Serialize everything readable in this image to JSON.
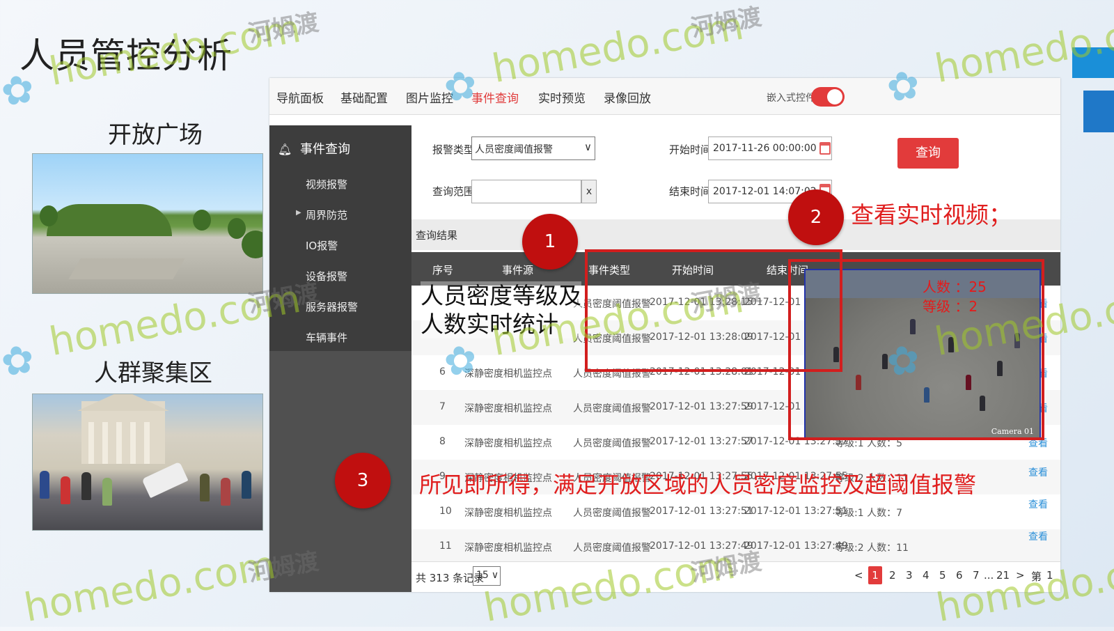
{
  "slide": {
    "title": "人员管控分析",
    "left_labels": [
      "开放广场",
      "人群聚集区"
    ]
  },
  "topnav": {
    "items": [
      "导航面板",
      "基础配置",
      "图片监控",
      "事件查询",
      "实时预览",
      "录像回放"
    ],
    "active": "事件查询",
    "embed_label": "嵌入式控件",
    "embed_toggle_on": true
  },
  "sidebar": {
    "header": "事件查询",
    "items": [
      "视频报警",
      "周界防范",
      "IO报警",
      "设备报警",
      "服务器报警",
      "车辆事件"
    ]
  },
  "form": {
    "alarm_type_label": "报警类型:",
    "alarm_type_value": "人员密度阈值报警",
    "range_label": "查询范围:",
    "range_value": "",
    "clear_label": "x",
    "start_label": "开始时间:",
    "start_value": "2017-11-26 00:00:00",
    "end_label": "结束时间:",
    "end_value": "2017-12-01 14:07:02",
    "query_button": "查询"
  },
  "results": {
    "label": "查询结果",
    "columns": [
      "序号",
      "事件源",
      "事件类型",
      "开始时间",
      "结束时间"
    ],
    "rows": [
      {
        "no": "",
        "source": "",
        "type": "人员密度阈值报警",
        "start": "2017-12-01 13:28:15",
        "end": "2017-12-01 13:",
        "info": "",
        "view": "查看"
      },
      {
        "no": "",
        "source": "",
        "type": "人员密度阈值报警",
        "start": "2017-12-01 13:28:09",
        "end": "2017-12-01 13",
        "info": "",
        "view": "查看"
      },
      {
        "no": "6",
        "source": "深静密度相机监控点",
        "type": "人员密度阈值报警",
        "start": "2017-12-01 13:28:01",
        "end": "2017-12-01 13",
        "info": "",
        "view": "查看"
      },
      {
        "no": "7",
        "source": "深静密度相机监控点",
        "type": "人员密度阈值报警",
        "start": "2017-12-01 13:27:59",
        "end": "2017-12-01 13",
        "info": "",
        "view": "查看"
      },
      {
        "no": "8",
        "source": "深静密度相机监控点",
        "type": "人员密度阈值报警",
        "start": "2017-12-01 13:27:57",
        "end": "2017-12-01 13:27:57",
        "info": "等级:1 人数：5",
        "view": "查看"
      },
      {
        "no": "9",
        "source": "深静密度相机监控点",
        "type": "人员密度阈值报警",
        "start": "2017-12-01 13:27:55",
        "end": "2017-12-01 13:27:55",
        "info": "等级:2 人数：11",
        "view": "查看"
      },
      {
        "no": "10",
        "source": "深静密度相机监控点",
        "type": "人员密度阈值报警",
        "start": "2017-12-01 13:27:51",
        "end": "2017-12-01 13:27:51",
        "info": "等级:1 人数：7",
        "view": "查看"
      },
      {
        "no": "11",
        "source": "深静密度相机监控点",
        "type": "人员密度阈值报警",
        "start": "2017-12-01 13:27:49",
        "end": "2017-12-01 13:27:49",
        "info": "等级:2 人数：11",
        "view": "查看"
      }
    ]
  },
  "pager": {
    "total": "共 313 条记录",
    "page_size": "15",
    "prev": "<",
    "pages": [
      "1",
      "2",
      "3",
      "4",
      "5",
      "6",
      "7",
      "...",
      "21"
    ],
    "current": "1",
    "next": ">",
    "goto_label": "第",
    "goto_value": "1"
  },
  "video_popup": {
    "count_text": "人数 ：25",
    "level_text": "等级 ：2",
    "camera_label": "Camera 01"
  },
  "annotations": {
    "marker_1": "1",
    "marker_2": "2",
    "marker_3": "3",
    "text_1_line1": "人员密度等级及",
    "text_1_line2": "人数实时统计",
    "text_2": "查看实时视频；",
    "text_3": "所见即所得，满足开放区域的人员密度监控及超阈值报警"
  },
  "watermark": {
    "latin": "homedo.com",
    "cn": "河姆渡"
  },
  "colors": {
    "accent_red": "#e23b3b",
    "marker_red": "#c00f0f",
    "link_blue": "#2a8fd8",
    "sidebar_dark": "#3d3d3d"
  }
}
